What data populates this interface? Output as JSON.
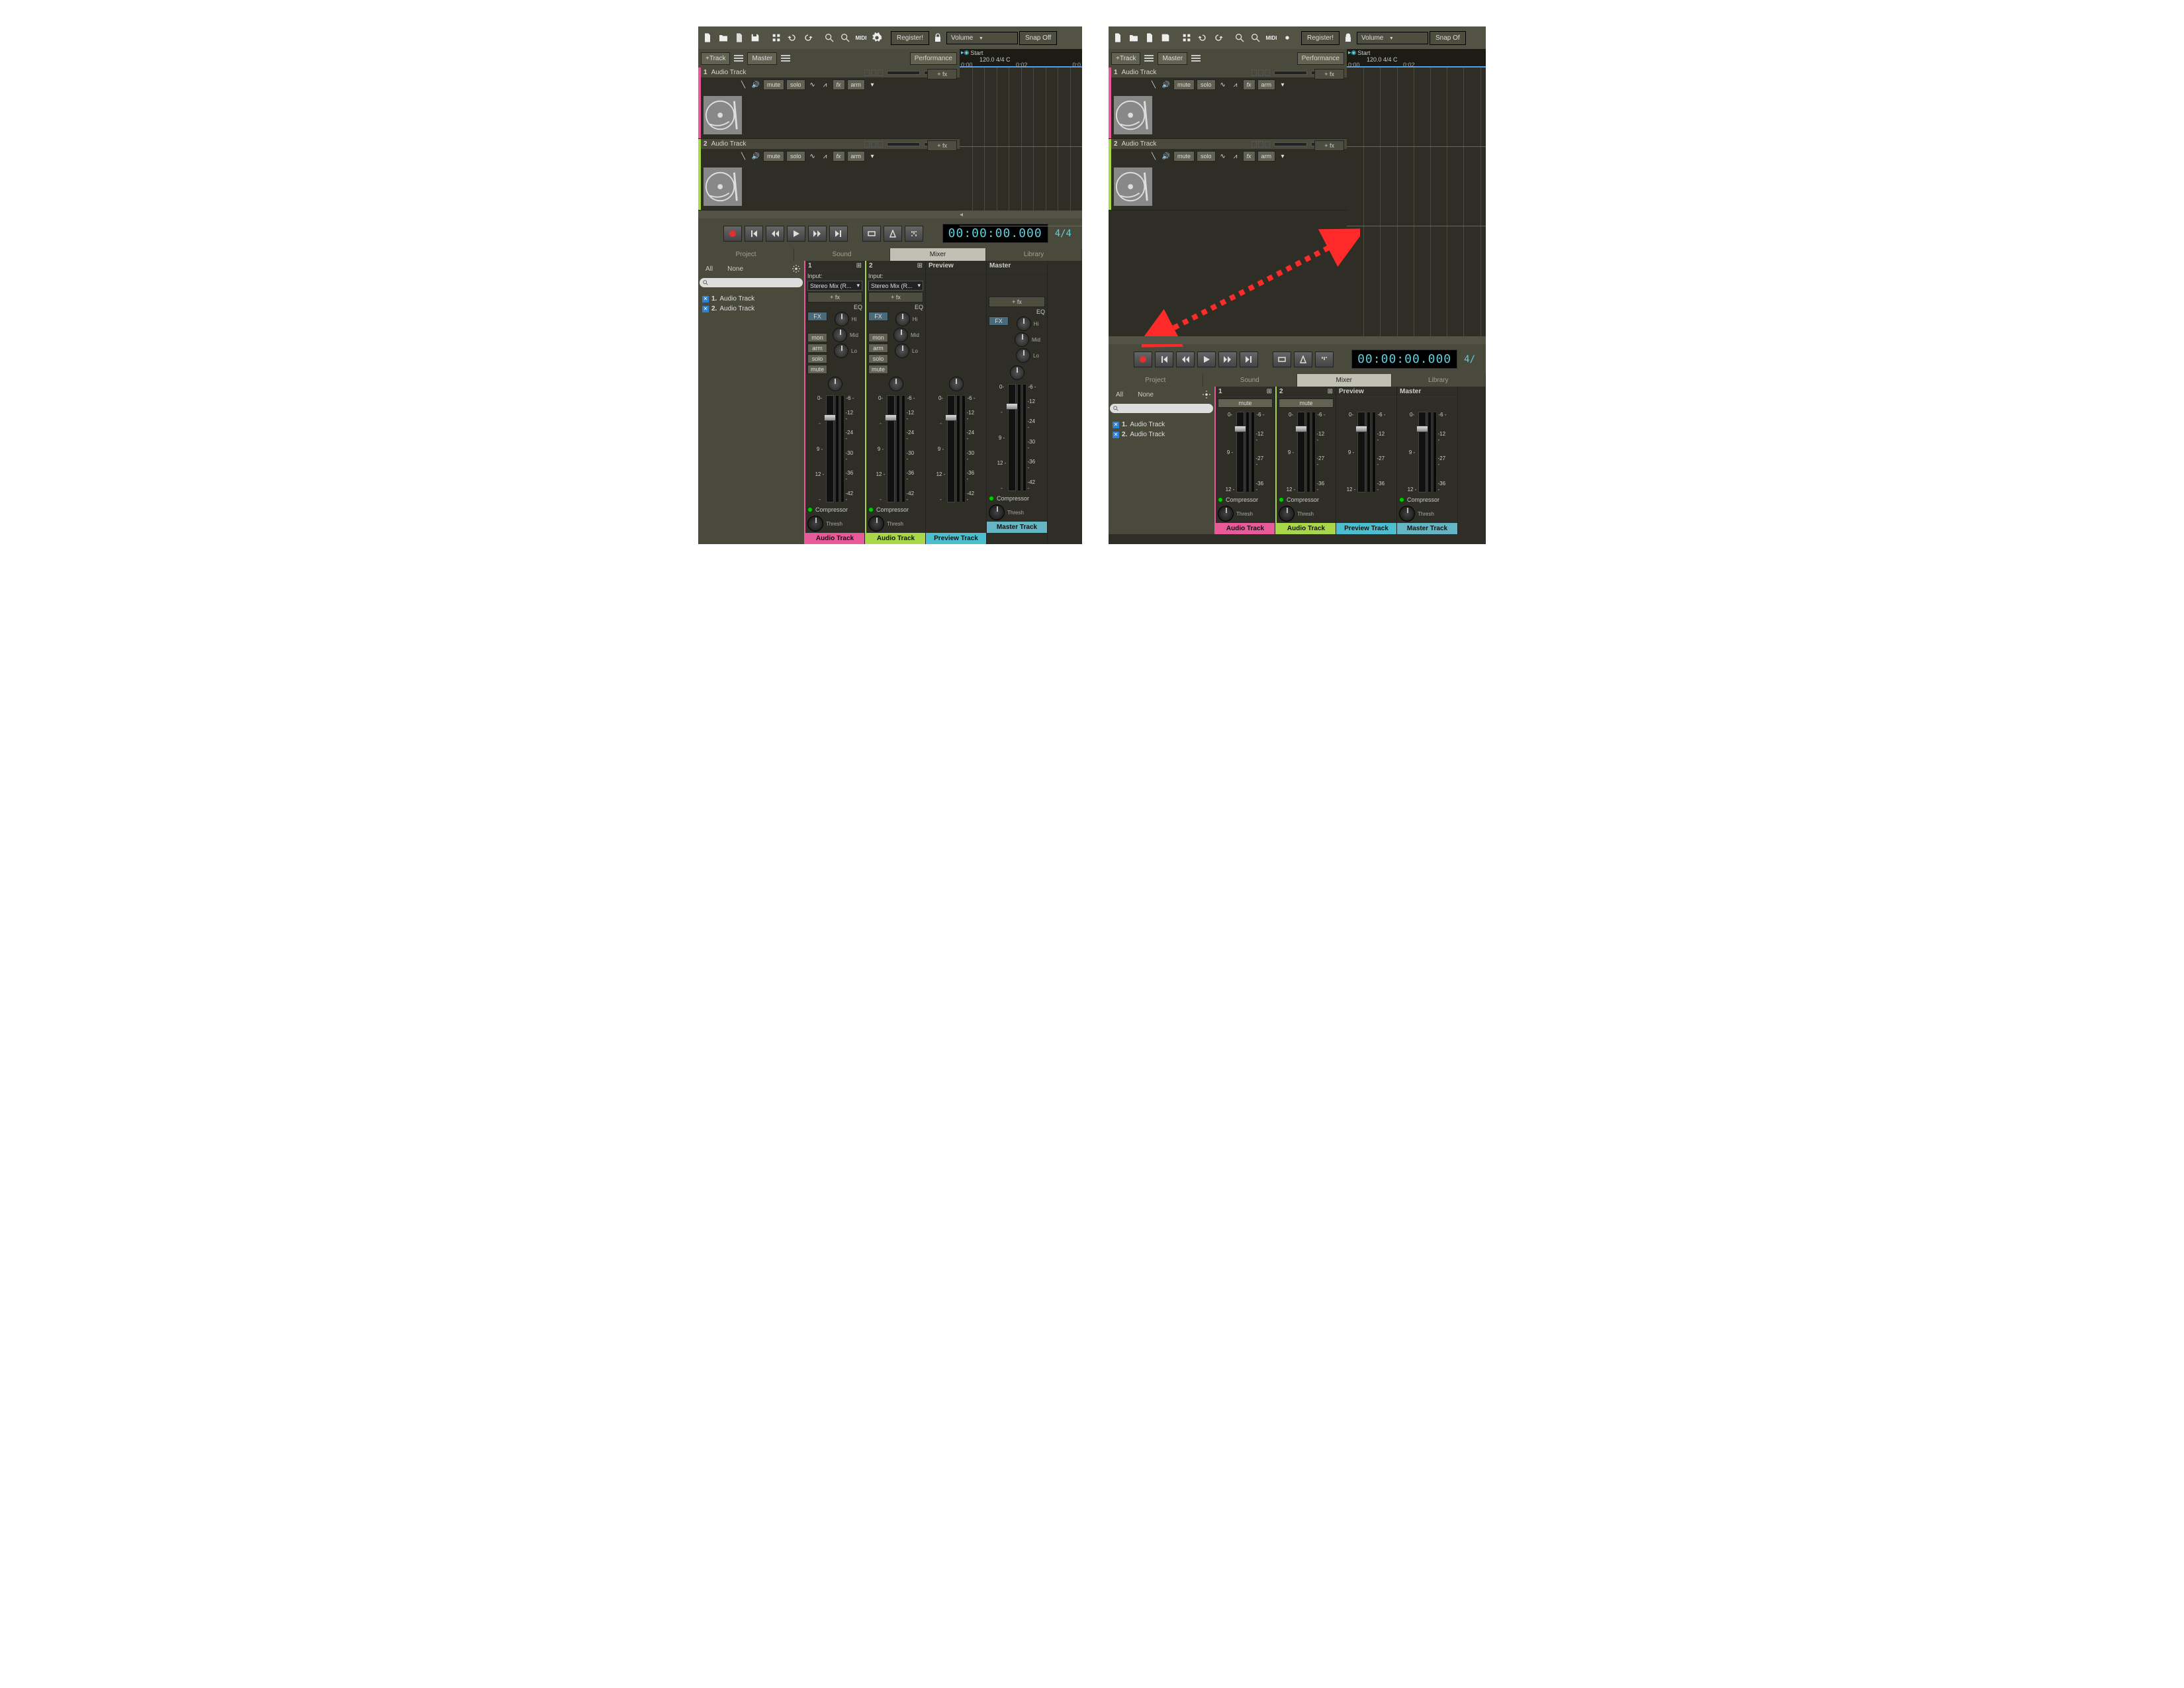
{
  "toolbar": {
    "register": "Register!",
    "volume": "Volume",
    "snap": "Snap Off"
  },
  "row2": {
    "addTrack": "+Track",
    "master": "Master",
    "performance": "Performance"
  },
  "timeline": {
    "flag": "Start",
    "tempo": "120.0 4/4 C",
    "t0": "0:00",
    "t1": "0:02",
    "t2": "0:0"
  },
  "tracks": [
    {
      "num": "1",
      "name": "Audio Track",
      "color": "#e85a9a"
    },
    {
      "num": "2",
      "name": "Audio Track",
      "color": "#a8d84a"
    }
  ],
  "trackBtns": {
    "mute": "mute",
    "solo": "solo",
    "fx": "fx",
    "arm": "arm",
    "addfx": "+ fx"
  },
  "transport": {
    "time": "00:00:00.000",
    "sig": "4/4"
  },
  "bottomTabs": {
    "project": "Project",
    "sound": "Sound",
    "mixer": "Mixer",
    "library": "Library"
  },
  "mixerLeft": {
    "all": "All",
    "none": "None",
    "items": [
      {
        "num": "1.",
        "name": "Audio Track"
      },
      {
        "num": "2.",
        "name": "Audio Track"
      }
    ]
  },
  "strip": {
    "input": "Input:",
    "inputVal": "Stereo Mix (R...",
    "addfx": "+ fx",
    "eq": "EQ",
    "fx": "FX",
    "hi": "Hi",
    "mid": "Mid",
    "lo": "Lo",
    "mon": "mon",
    "arm": "arm",
    "solo": "solo",
    "mute": "mute",
    "compressor": "Compressor",
    "thresh": "Thresh",
    "scaleA": [
      "0-",
      "-",
      "9 -",
      "12 -",
      "-"
    ],
    "scaleB": [
      "-6 -",
      "-12 -",
      "-24 -",
      "-30 -",
      "-36 -",
      "-42 -"
    ],
    "scaleBshort": [
      "-6 -",
      "-12 -",
      "-27 -",
      "-36 -"
    ],
    "previewLabel": "Preview",
    "masterLabel": "Master",
    "foot": {
      "audio": "Audio Track",
      "preview": "Preview Track",
      "master": "Master Track"
    }
  }
}
